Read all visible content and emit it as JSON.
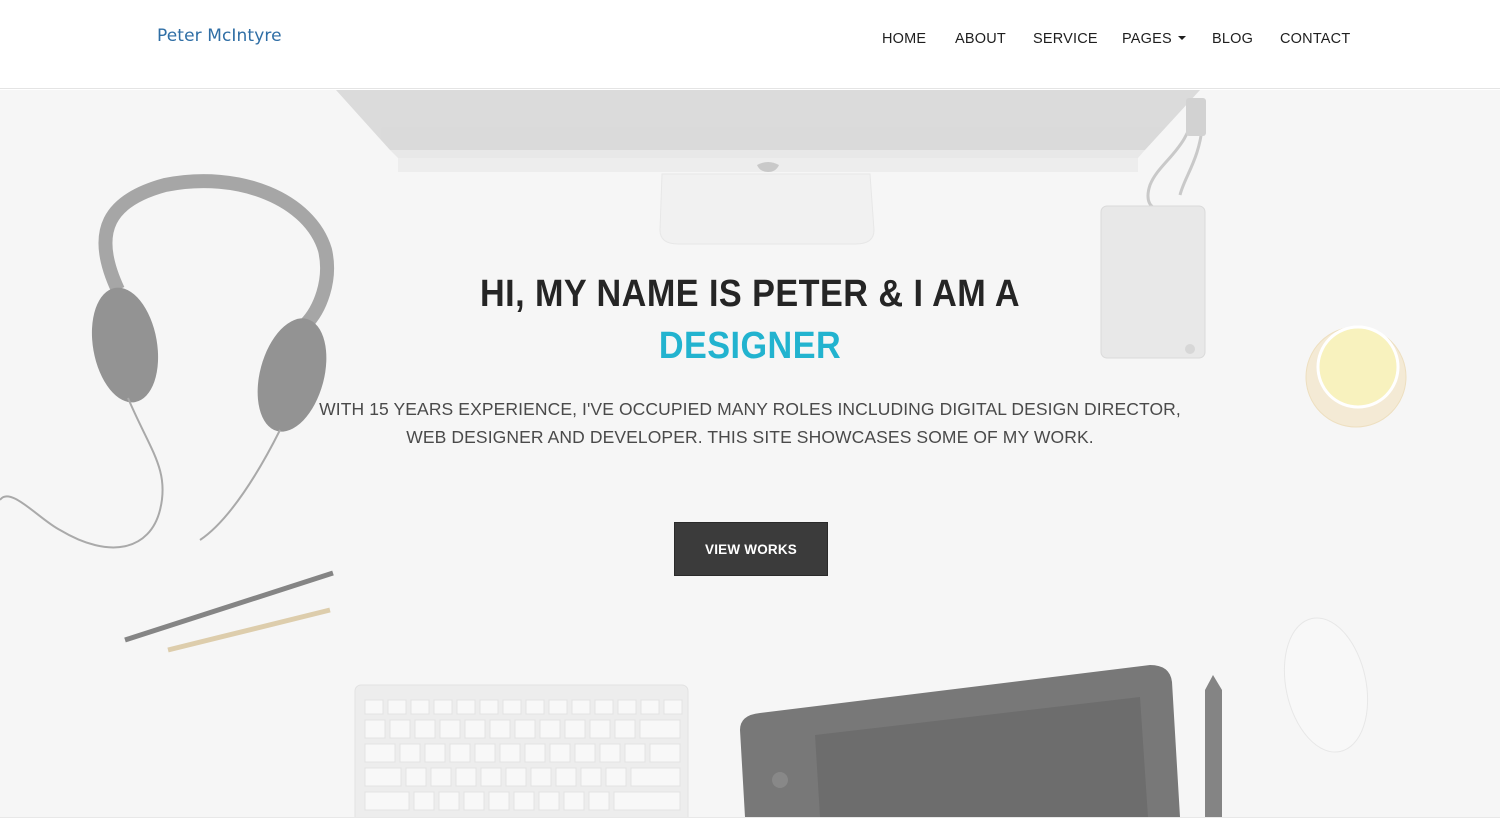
{
  "header": {
    "brand": "Peter McIntyre",
    "nav": {
      "home": "HOME",
      "about": "ABOUT",
      "service": "SERVICE",
      "pages": "PAGES",
      "blog": "BLOG",
      "contact": "CONTACT"
    }
  },
  "hero": {
    "headline": "HI, MY NAME IS PETER & I AM A",
    "role": "DESIGNER",
    "intro_line1": "WITH 15 YEARS EXPERIENCE, I'VE OCCUPIED MANY ROLES INCLUDING DIGITAL DESIGN DIRECTOR,",
    "intro_line2": "WEB DESIGNER AND DEVELOPER. THIS SITE SHOWCASES SOME OF MY WORK.",
    "cta_label": "VIEW WORKS"
  },
  "colors": {
    "brand": "#2f6ea5",
    "accent": "#22b3cf",
    "button": "#3b3b3b"
  }
}
